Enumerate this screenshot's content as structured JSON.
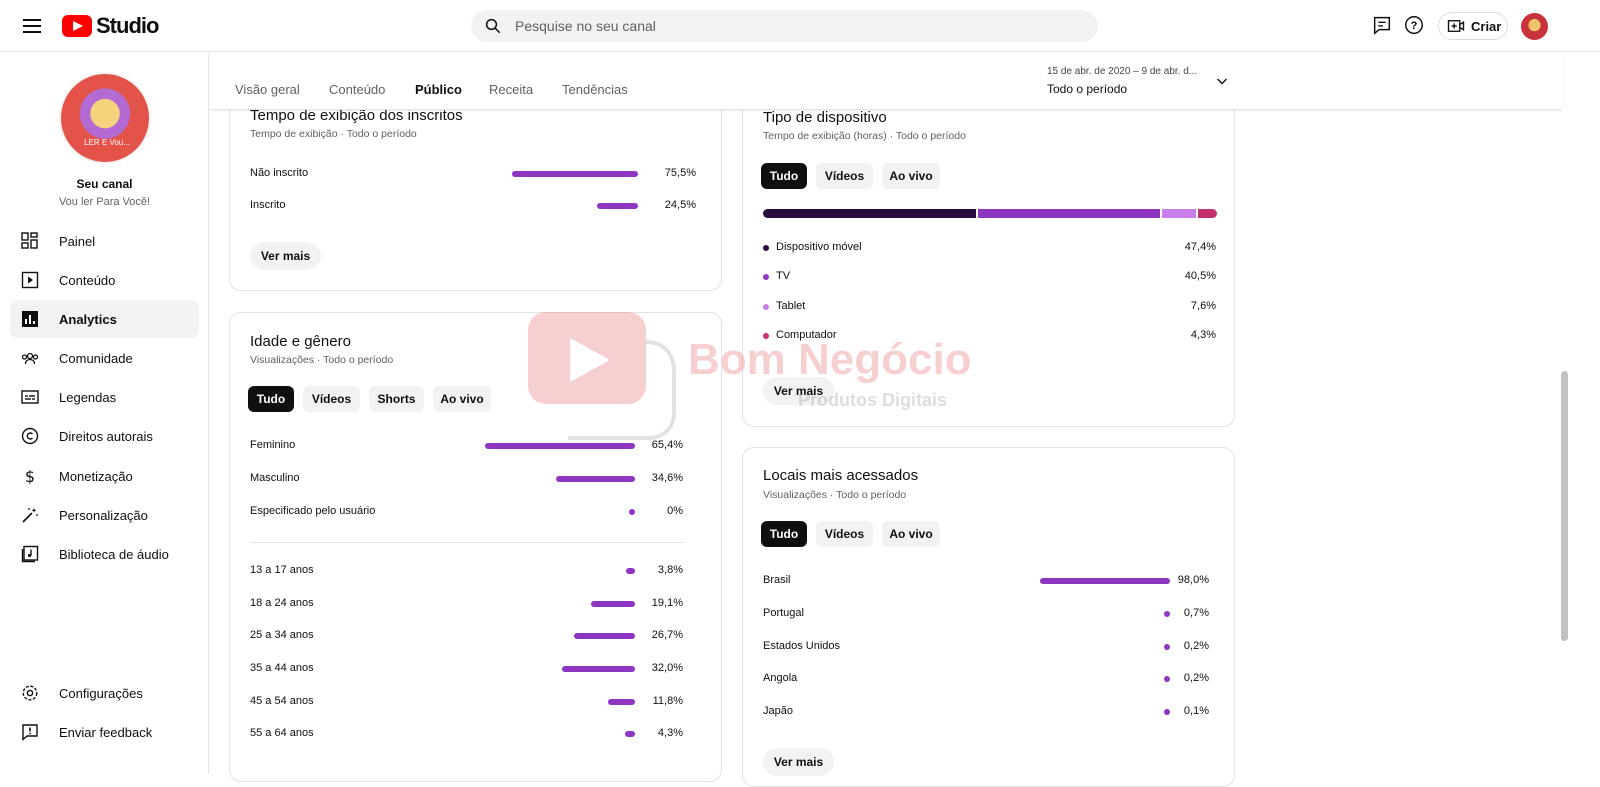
{
  "topbar": {
    "logo_text": "Studio",
    "search_placeholder": "Pesquise no seu canal",
    "create_label": "Criar"
  },
  "sidebar": {
    "channel_title": "Seu canal",
    "channel_name": "Vou ler Para Você!",
    "avatar_text": "LER E Vou...",
    "items": [
      {
        "label": "Painel",
        "icon": "dashboard-icon"
      },
      {
        "label": "Conteúdo",
        "icon": "content-icon"
      },
      {
        "label": "Analytics",
        "icon": "analytics-icon",
        "active": true
      },
      {
        "label": "Comunidade",
        "icon": "community-icon"
      },
      {
        "label": "Legendas",
        "icon": "subtitles-icon"
      },
      {
        "label": "Direitos autorais",
        "icon": "copyright-icon"
      },
      {
        "label": "Monetização",
        "icon": "monetization-icon"
      },
      {
        "label": "Personalização",
        "icon": "customization-icon"
      },
      {
        "label": "Biblioteca de áudio",
        "icon": "audio-library-icon"
      }
    ],
    "bottom_items": [
      {
        "label": "Configurações",
        "icon": "settings-icon"
      },
      {
        "label": "Enviar feedback",
        "icon": "feedback-icon"
      }
    ]
  },
  "header": {
    "tabs": [
      "Visão geral",
      "Conteúdo",
      "Público",
      "Receita",
      "Tendências"
    ],
    "active_tab": "Público",
    "period_range": "15 de abr. de 2020 – 9 de abr. d...",
    "period_label": "Todo o período"
  },
  "subscribers_card": {
    "title": "Tempo de exibição dos inscritos",
    "subtitle": "Tempo de exibição · Todo o período",
    "rows": [
      {
        "label": "Não inscrito",
        "value": "75,5%",
        "pct": 75.5
      },
      {
        "label": "Inscrito",
        "value": "24,5%",
        "pct": 24.5
      }
    ],
    "more_label": "Ver mais"
  },
  "age_gender_card": {
    "title": "Idade e gênero",
    "subtitle": "Visualizações · Todo o período",
    "chips": [
      "Tudo",
      "Vídeos",
      "Shorts",
      "Ao vivo"
    ],
    "gender_rows": [
      {
        "label": "Feminino",
        "value": "65,4%",
        "pct": 65.4
      },
      {
        "label": "Masculino",
        "value": "34,6%",
        "pct": 34.6
      },
      {
        "label": "Especificado pelo usuário",
        "value": "0%",
        "pct": 0
      }
    ],
    "age_rows": [
      {
        "label": "13 a 17 anos",
        "value": "3,8%",
        "pct": 3.8
      },
      {
        "label": "18 a 24 anos",
        "value": "19,1%",
        "pct": 19.1
      },
      {
        "label": "25 a 34 anos",
        "value": "26,7%",
        "pct": 26.7
      },
      {
        "label": "35 a 44 anos",
        "value": "32,0%",
        "pct": 32.0
      },
      {
        "label": "45 a 54 anos",
        "value": "11,8%",
        "pct": 11.8
      },
      {
        "label": "55 a 64 anos",
        "value": "4,3%",
        "pct": 4.3
      }
    ]
  },
  "device_card": {
    "title": "Tipo de dispositivo",
    "subtitle": "Tempo de exibição (horas) · Todo o período",
    "chips": [
      "Tudo",
      "Vídeos",
      "Ao vivo"
    ],
    "rows": [
      {
        "label": "Dispositivo móvel",
        "value": "47,4%",
        "pct": 47.4,
        "color": "#2b0a3d"
      },
      {
        "label": "TV",
        "value": "40,5%",
        "pct": 40.5,
        "color": "#8e35c2"
      },
      {
        "label": "Tablet",
        "value": "7,6%",
        "pct": 7.6,
        "color": "#c77ee8"
      },
      {
        "label": "Computador",
        "value": "4,3%",
        "pct": 4.3,
        "color": "#c2306e"
      }
    ],
    "more_label": "Ver mais"
  },
  "locations_card": {
    "title": "Locais mais acessados",
    "subtitle": "Visualizações · Todo o período",
    "chips": [
      "Tudo",
      "Vídeos",
      "Ao vivo"
    ],
    "rows": [
      {
        "label": "Brasil",
        "value": "98,0%",
        "pct": 98.0
      },
      {
        "label": "Portugal",
        "value": "0,7%",
        "pct": 0.7
      },
      {
        "label": "Estados Unidos",
        "value": "0,2%",
        "pct": 0.2
      },
      {
        "label": "Angola",
        "value": "0,2%",
        "pct": 0.2
      },
      {
        "label": "Japão",
        "value": "0,1%",
        "pct": 0.1
      }
    ],
    "more_label": "Ver mais"
  },
  "watermark": {
    "brand": "Bom Negócio",
    "tagline": "Produtos Digitais"
  },
  "colors": {
    "accent": "#8e35c2",
    "brand_red": "#ff0000"
  }
}
